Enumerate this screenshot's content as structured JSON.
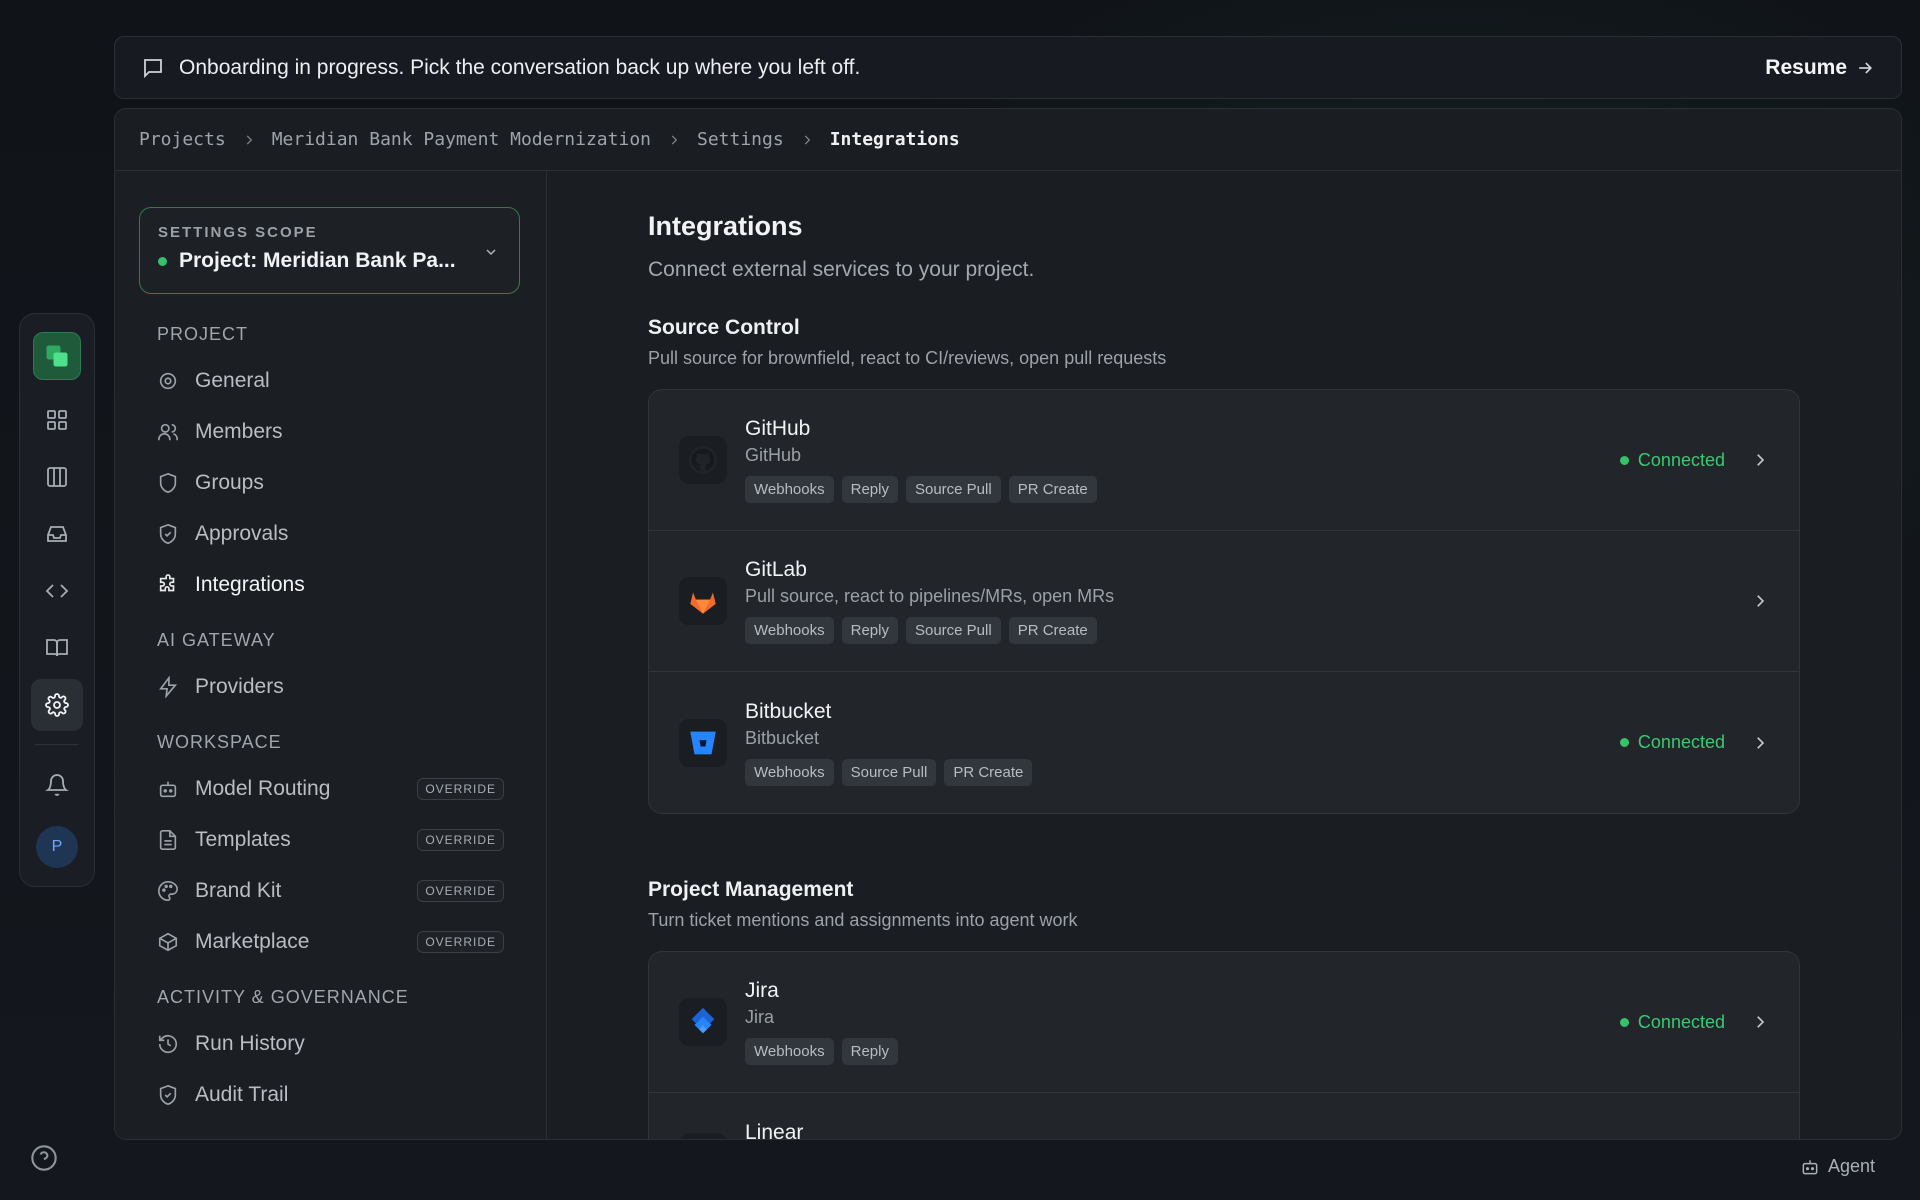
{
  "banner": {
    "text": "Onboarding in progress. Pick the conversation back up where you left off.",
    "action": "Resume"
  },
  "breadcrumb": [
    "Projects",
    "Meridian Bank Payment Modernization",
    "Settings",
    "Integrations"
  ],
  "scope": {
    "label": "SETTINGS SCOPE",
    "value": "Project: Meridian Bank Pa..."
  },
  "nav": {
    "project": {
      "heading": "PROJECT",
      "items": [
        "General",
        "Members",
        "Groups",
        "Approvals",
        "Integrations"
      ]
    },
    "ai_gateway": {
      "heading": "AI GATEWAY",
      "items": [
        "Providers"
      ]
    },
    "workspace": {
      "heading": "WORKSPACE",
      "items": [
        "Model Routing",
        "Templates",
        "Brand Kit",
        "Marketplace"
      ],
      "badge": "OVERRIDE"
    },
    "activity": {
      "heading": "ACTIVITY & GOVERNANCE",
      "items": [
        "Run History",
        "Audit Trail"
      ]
    }
  },
  "page": {
    "title": "Integrations",
    "subtitle": "Connect external services to your project."
  },
  "source_control": {
    "title": "Source Control",
    "subtitle": "Pull source for brownfield, react to CI/reviews, open pull requests",
    "items": [
      {
        "name": "GitHub",
        "sub": "GitHub",
        "status": "Connected",
        "tags": [
          "Webhooks",
          "Reply",
          "Source Pull",
          "PR Create"
        ]
      },
      {
        "name": "GitLab",
        "sub": "Pull source, react to pipelines/MRs, open MRs",
        "status": "",
        "tags": [
          "Webhooks",
          "Reply",
          "Source Pull",
          "PR Create"
        ]
      },
      {
        "name": "Bitbucket",
        "sub": "Bitbucket",
        "status": "Connected",
        "tags": [
          "Webhooks",
          "Source Pull",
          "PR Create"
        ]
      }
    ]
  },
  "project_management": {
    "title": "Project Management",
    "subtitle": "Turn ticket mentions and assignments into agent work",
    "items": [
      {
        "name": "Jira",
        "sub": "Jira",
        "status": "Connected",
        "tags": [
          "Webhooks",
          "Reply"
        ]
      },
      {
        "name": "Linear",
        "sub": "",
        "status": "",
        "tags": []
      }
    ]
  },
  "rail": {
    "avatar_initial": "P"
  },
  "agent": {
    "label": "Agent"
  },
  "colors": {
    "accent_green": "#35c26b",
    "gitlab_orange": "#f26b2a",
    "bitbucket_blue": "#2684ff",
    "jira_blue": "#2684ff",
    "linear_purple": "#6f6fd8"
  }
}
